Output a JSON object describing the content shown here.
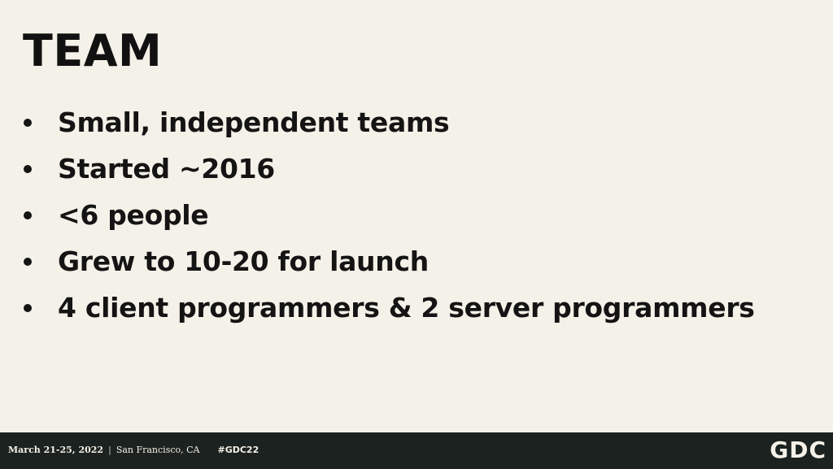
{
  "slide": {
    "title": "TEAM",
    "bullets": [
      "Small, independent teams",
      "Started ~2016",
      "<6 people",
      "Grew to 10-20 for launch",
      "4 client programmers & 2 server programmers"
    ]
  },
  "footer": {
    "dates": "March 21-25, 2022",
    "separator": "|",
    "location": "San Francisco, CA",
    "hashtag": "#GDC22",
    "logo": "GDC"
  },
  "colors": {
    "background": "#f4f1e8",
    "text": "#141414",
    "footer_background": "#1c221f",
    "footer_text": "#f4f1e8"
  }
}
